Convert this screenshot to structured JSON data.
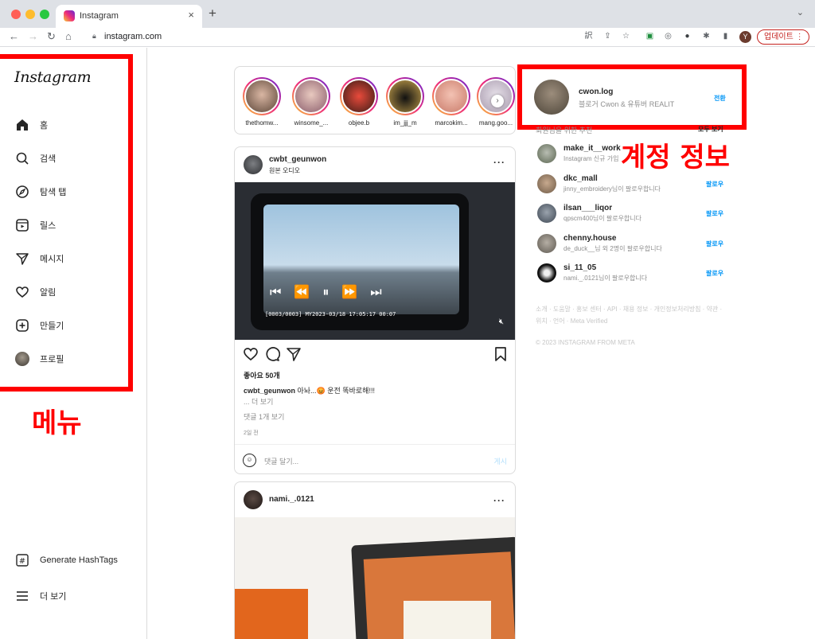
{
  "browser": {
    "tab_title": "Instagram",
    "url": "instagram.com",
    "profile_initial": "Y",
    "update_label": "업데이트"
  },
  "sidebar": {
    "logo": "Instagram",
    "items": [
      {
        "label": "홈",
        "icon": "home-icon"
      },
      {
        "label": "검색",
        "icon": "search-icon"
      },
      {
        "label": "탐색 탭",
        "icon": "compass-icon"
      },
      {
        "label": "릴스",
        "icon": "reels-icon"
      },
      {
        "label": "메시지",
        "icon": "send-icon"
      },
      {
        "label": "알림",
        "icon": "heart-icon"
      },
      {
        "label": "만들기",
        "icon": "plus-square-icon"
      },
      {
        "label": "프로필",
        "icon": "profile-avatar"
      }
    ],
    "bottom_items": [
      {
        "label": "Generate HashTags",
        "icon": "hashtag-icon"
      },
      {
        "label": "더 보기",
        "icon": "menu-icon"
      }
    ]
  },
  "annotations": {
    "menu_label": "메뉴",
    "account_label": "계정 정보",
    "color": "#ff0000"
  },
  "stories": [
    {
      "name": "thethomw..."
    },
    {
      "name": "winsome_..."
    },
    {
      "name": "objee.b"
    },
    {
      "name": "im_jjj_m"
    },
    {
      "name": "marcokim..."
    },
    {
      "name": "mang.goo..."
    }
  ],
  "post1": {
    "username": "cwbt_geunwon",
    "subtitle": "원본 오디오",
    "video_timestamp": "[0003/0003] MY2023-03/18 17:05:17 00:07",
    "likes": "좋아요 50개",
    "caption_user": "cwbt_geunwon",
    "caption_text": " 아놔...😡 운전 똑바로해!!!",
    "more": "... 더 보기",
    "comments_link": "댓글 1개 보기",
    "time": "2일 전",
    "comment_placeholder": "댓글 달기...",
    "post_button": "게시"
  },
  "post2": {
    "username": "nami._.0121"
  },
  "account": {
    "username": "cwon.log",
    "name": "블로거 Cwon & 유튜버 REALIT",
    "switch_label": "전환"
  },
  "suggestions": {
    "header": "회원님을 위한 추천",
    "see_all": "모두 보기",
    "items": [
      {
        "username": "make_it__work",
        "sub": "Instagram 신규 가입",
        "follow": ""
      },
      {
        "username": "dkc_mall",
        "sub": "jinny_embroidery님이 팔로우합니다",
        "follow": "팔로우"
      },
      {
        "username": "ilsan___liqor",
        "sub": "qpscm400님이 팔로우합니다",
        "follow": "팔로우"
      },
      {
        "username": "chenny.house",
        "sub": "de_duck__님 외 2명이 팔로우합니다",
        "follow": "팔로우"
      },
      {
        "username": "si_11_05",
        "sub": "nami._.0121님이 팔로우합니다",
        "follow": "팔로우"
      }
    ]
  },
  "footer": {
    "links": "소개 · 도움말 · 홍보 센터 · API · 채용 정보 · 개인정보처리방침 · 약관 · 위치 · 언어 · Meta Verified",
    "copyright": "© 2023 INSTAGRAM FROM META"
  }
}
